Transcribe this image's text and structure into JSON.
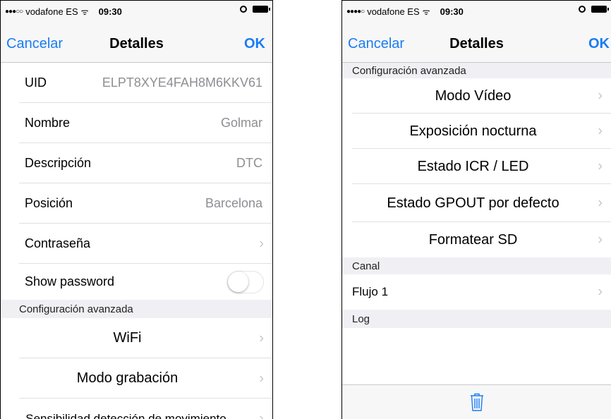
{
  "left": {
    "status": {
      "carrier": "vodafone ES",
      "time": "09:30"
    },
    "nav": {
      "cancel": "Cancelar",
      "title": "Detalles",
      "ok": "OK"
    },
    "rows": {
      "uid": {
        "label": "UID",
        "value": "ELPT8XYE4FAH8M6KKV61"
      },
      "nombre": {
        "label": "Nombre",
        "value": "Golmar"
      },
      "descripcion": {
        "label": "Descripción",
        "value": "DTC"
      },
      "posicion": {
        "label": "Posición",
        "value": "Barcelona"
      },
      "contrasena": {
        "label": "Contraseña"
      },
      "show_password": {
        "label": "Show password",
        "on": false
      }
    },
    "section_header": "Configuración avanzada",
    "advanced": {
      "wifi": "WiFi",
      "modo_grabacion": "Modo grabación",
      "sensibilidad": "Sensibilidad detección de movimiento"
    }
  },
  "right": {
    "status": {
      "carrier": "vodafone ES",
      "time": "09:30"
    },
    "nav": {
      "cancel": "Cancelar",
      "title": "Detalles",
      "ok": "OK"
    },
    "section_advanced": "Configuración avanzada",
    "advanced": {
      "modo_video": "Modo Vídeo",
      "exposicion": "Exposición nocturna",
      "estado_icr": "Estado ICR / LED",
      "estado_gpout": "Estado GPOUT por defecto",
      "formatear": "Formatear SD"
    },
    "section_canal": "Canal",
    "canal": {
      "flujo": "Flujo 1"
    },
    "section_log": "Log"
  },
  "icons": {
    "chevron": "chevron-right-icon",
    "trash": "trash-icon",
    "accent": "#1a7cf5"
  }
}
